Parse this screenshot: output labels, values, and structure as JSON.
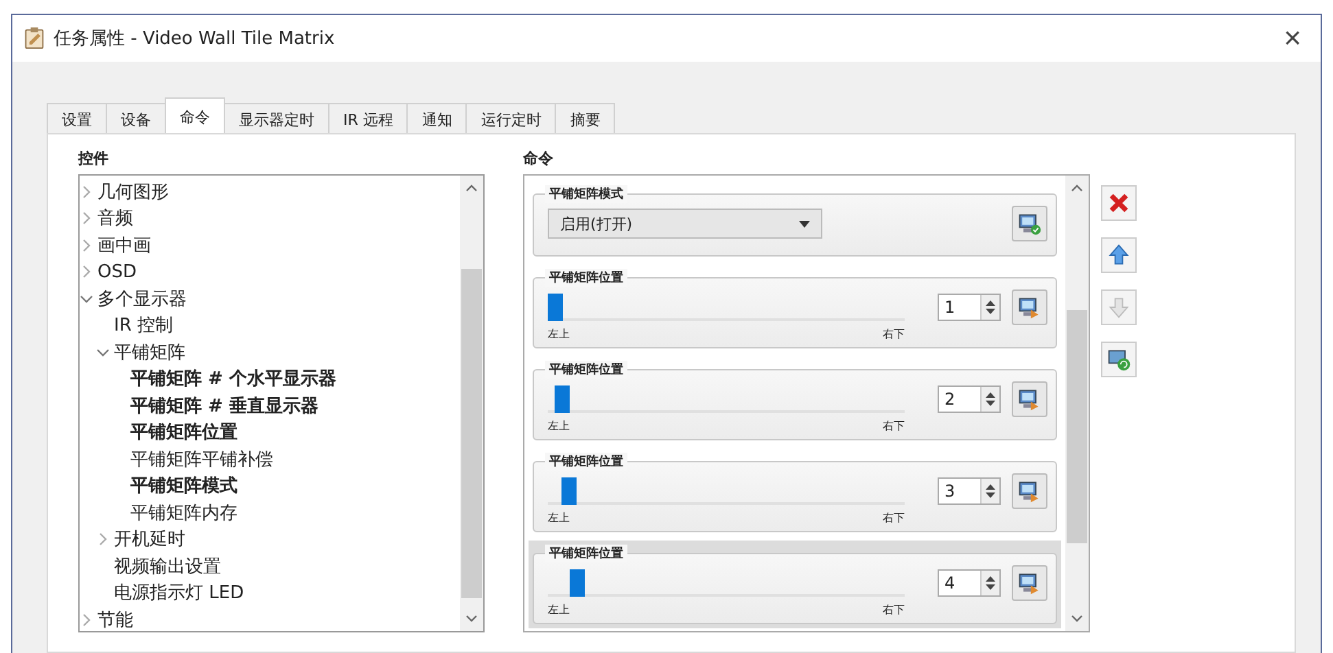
{
  "window": {
    "title": "任务属性 - Video Wall Tile Matrix",
    "close": "×"
  },
  "tabs": [
    {
      "label": "设置",
      "selected": false
    },
    {
      "label": "设备",
      "selected": false
    },
    {
      "label": "命令",
      "selected": true
    },
    {
      "label": "显示器定时",
      "selected": false
    },
    {
      "label": "IR 远程",
      "selected": false
    },
    {
      "label": "通知",
      "selected": false
    },
    {
      "label": "运行定时",
      "selected": false
    },
    {
      "label": "摘要",
      "selected": false
    }
  ],
  "controls": {
    "title": "控件",
    "tree": [
      {
        "label": "几何图形",
        "expanded": false,
        "bold": false
      },
      {
        "label": "音频",
        "expanded": false,
        "bold": false
      },
      {
        "label": "画中画",
        "expanded": false,
        "bold": false
      },
      {
        "label": "OSD",
        "expanded": false,
        "bold": false
      },
      {
        "label": "多个显示器",
        "expanded": true,
        "bold": false,
        "children": [
          {
            "label": "IR 控制",
            "bold": false
          },
          {
            "label": "平铺矩阵",
            "expanded": true,
            "bold": false,
            "children": [
              {
                "label": "平铺矩阵 # 个水平显示器",
                "bold": true
              },
              {
                "label": "平铺矩阵 # 垂直显示器",
                "bold": true
              },
              {
                "label": "平铺矩阵位置",
                "bold": true
              },
              {
                "label": "平铺矩阵平铺补偿",
                "bold": false
              },
              {
                "label": "平铺矩阵模式",
                "bold": true
              },
              {
                "label": "平铺矩阵内存",
                "bold": false
              }
            ]
          },
          {
            "label": "开机延时",
            "expanded": false,
            "bold": false
          },
          {
            "label": "视频输出设置",
            "bold": false
          },
          {
            "label": "电源指示灯 LED",
            "bold": false
          }
        ]
      },
      {
        "label": "节能",
        "expanded": false,
        "bold": false
      }
    ]
  },
  "commands": {
    "title": "命令",
    "items": [
      {
        "kind": "dropdown",
        "title": "平铺矩阵模式",
        "value": "启用(打开)",
        "selected": false
      },
      {
        "kind": "slider",
        "title": "平铺矩阵位置",
        "level": 0,
        "value": "1",
        "min_label": "左上",
        "max_label": "右下",
        "selected": false
      },
      {
        "kind": "slider",
        "title": "平铺矩阵位置",
        "level": 0.02,
        "value": "2",
        "min_label": "左上",
        "max_label": "右下",
        "selected": false
      },
      {
        "kind": "slider",
        "title": "平铺矩阵位置",
        "level": 0.04,
        "value": "3",
        "min_label": "左上",
        "max_label": "右下",
        "selected": false
      },
      {
        "kind": "slider",
        "title": "平铺矩阵位置",
        "level": 0.06,
        "value": "4",
        "min_label": "左上",
        "max_label": "右下",
        "selected": true
      }
    ]
  }
}
